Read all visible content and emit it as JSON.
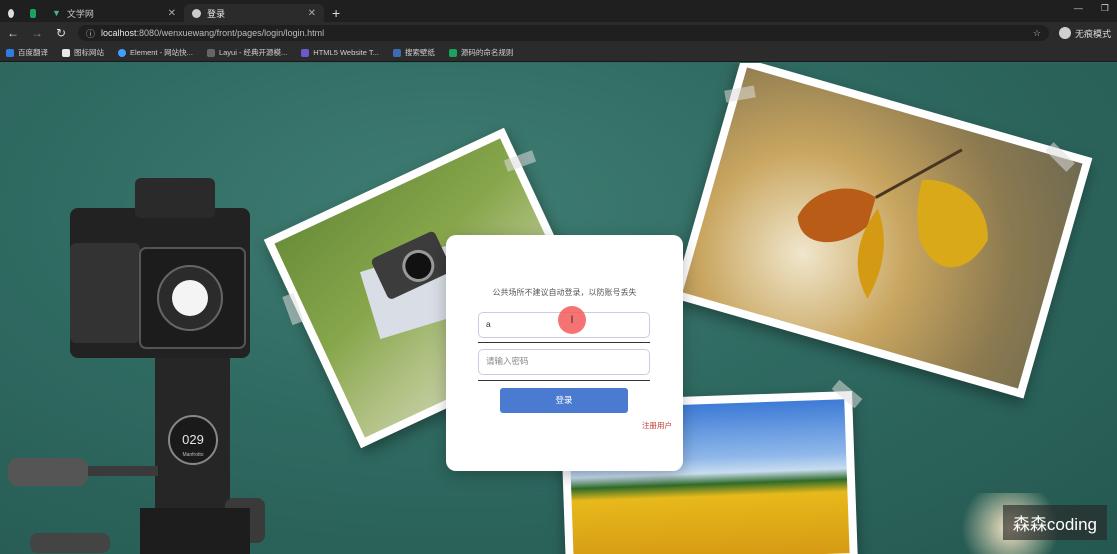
{
  "browser": {
    "tabs": [
      {
        "label": "文学网",
        "active": false
      },
      {
        "label": "登录",
        "active": true
      }
    ],
    "url_host": "localhost",
    "url_path": ":8080/wenxuewang/front/pages/login/login.html",
    "incognito_label": "无痕模式",
    "bookmarks": [
      {
        "label": "百度翻译",
        "color": "#2f7de1"
      },
      {
        "label": "图标网站",
        "color": "#333333"
      },
      {
        "label": "Element - 网站快...",
        "color": "#409eff"
      },
      {
        "label": "Layui - 经典开源模...",
        "color": "#555555"
      },
      {
        "label": "HTML5 Website T...",
        "color": "#6a5acd"
      },
      {
        "label": "搜索壁纸",
        "color": "#3d6bb3"
      },
      {
        "label": "源码的命名规则",
        "color": "#1aa260"
      }
    ]
  },
  "login": {
    "notice": "公共场所不建议自动登录，以防账号丢失",
    "username_value": "a",
    "password_placeholder": "请输入密码",
    "login_button": "登录",
    "register_link": "注册用户"
  },
  "camera": {
    "dial_text": "029",
    "brand_text": "Manfrotto"
  },
  "cursor_text": "I",
  "watermark": "森森coding"
}
